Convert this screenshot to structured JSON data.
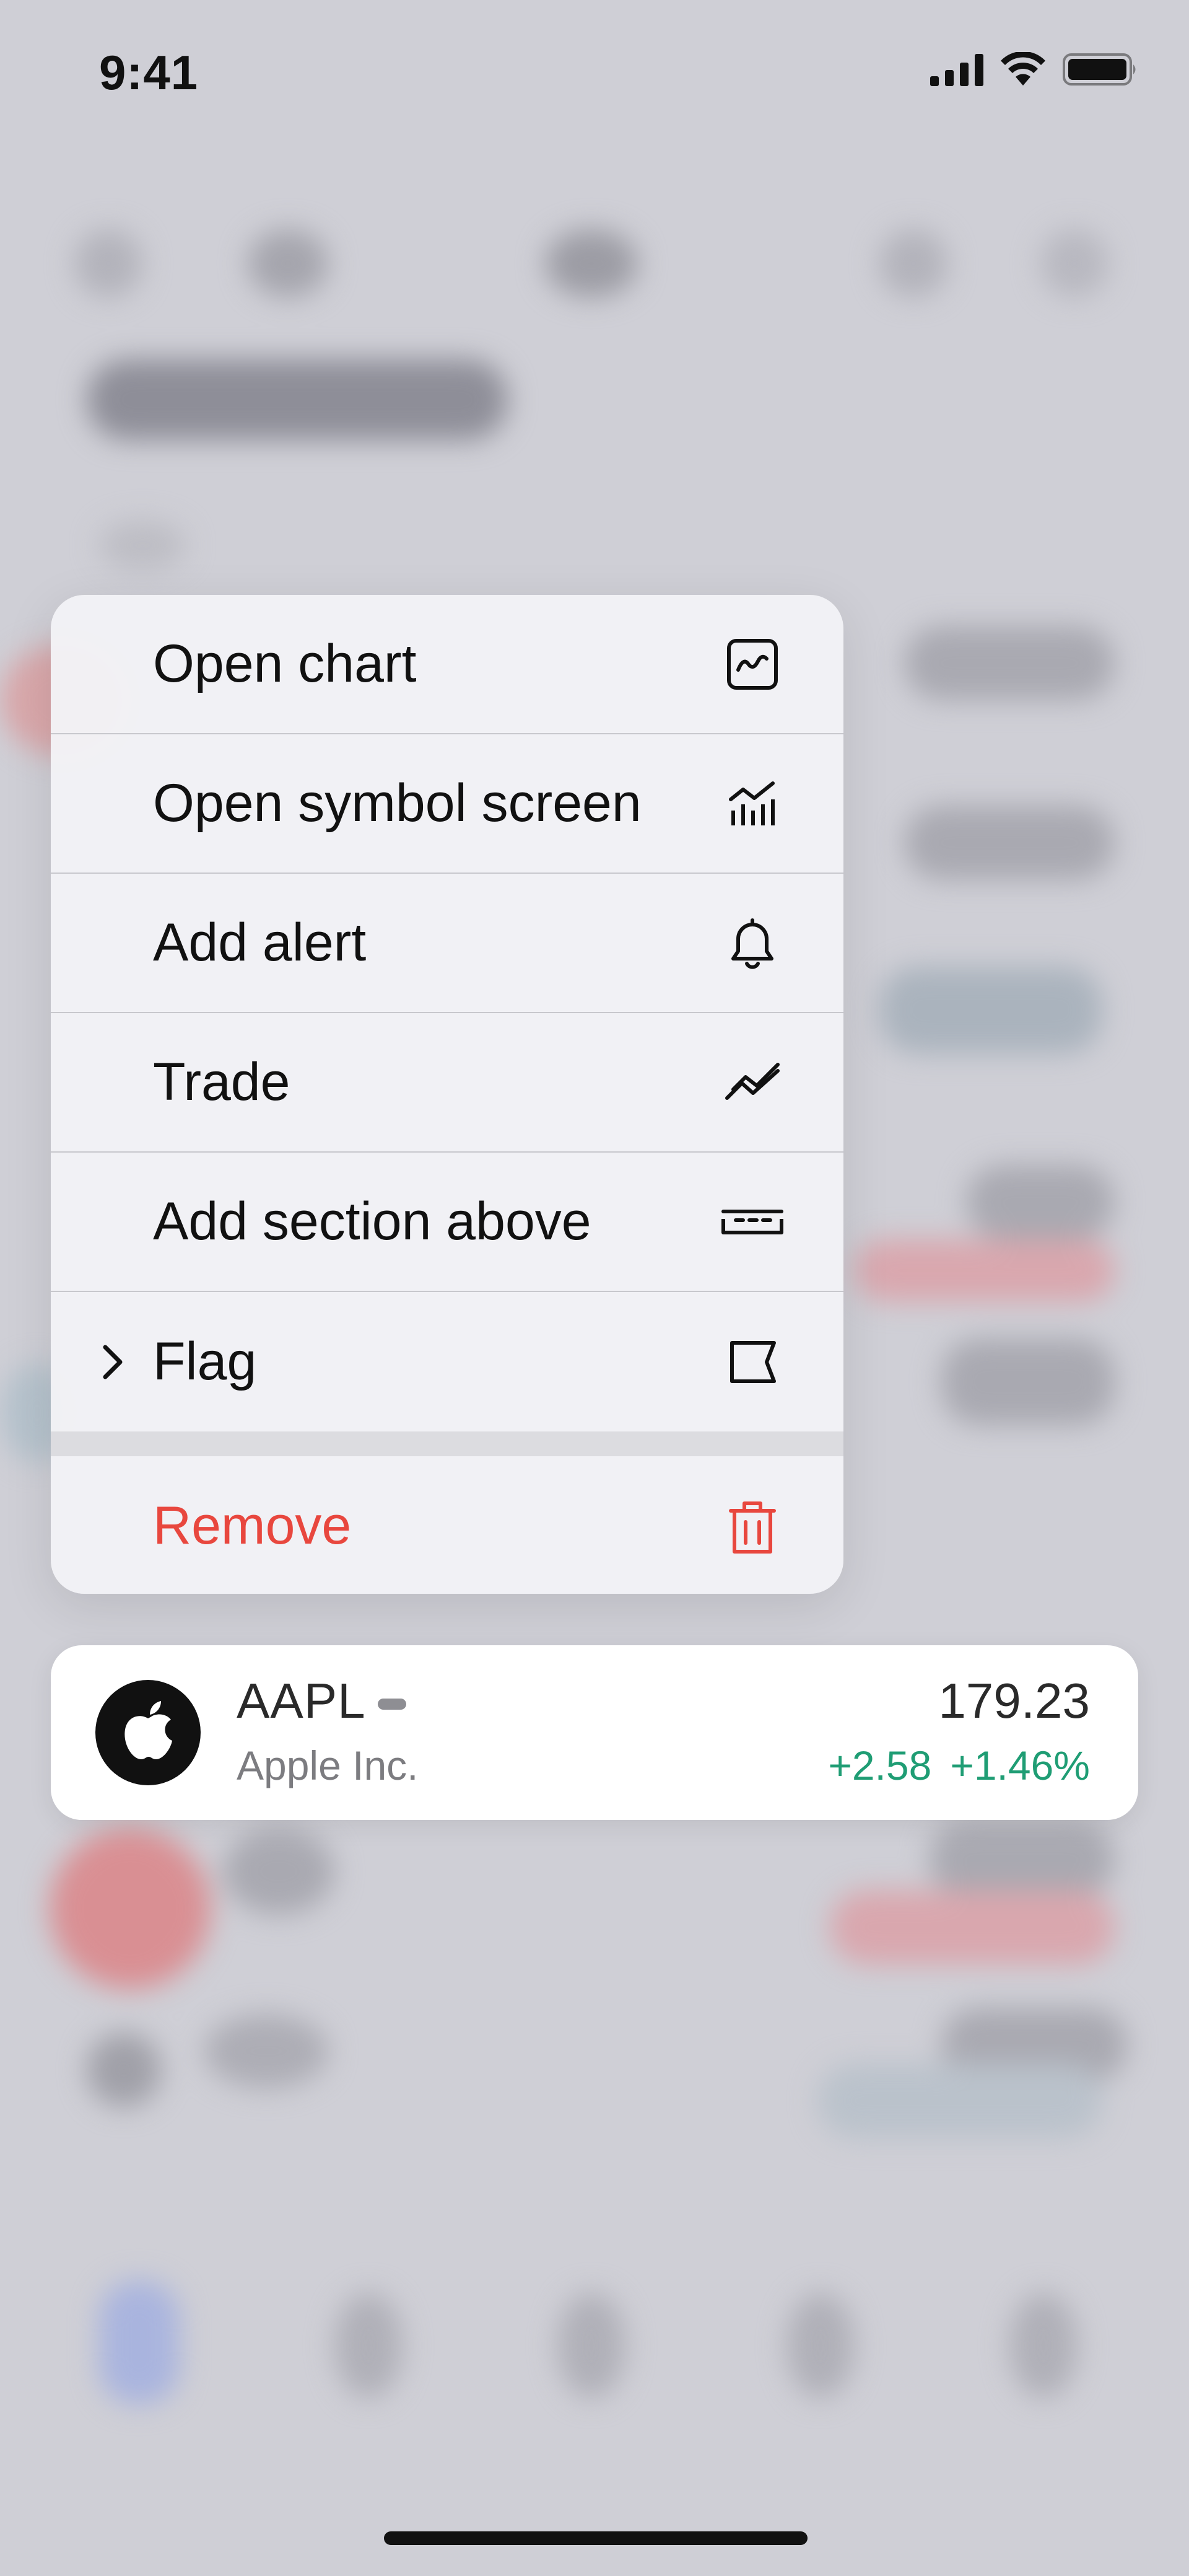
{
  "status_bar": {
    "time": "9:41",
    "icons": [
      "cellular-signal-icon",
      "wifi-icon",
      "battery-icon"
    ]
  },
  "context_menu": {
    "items": [
      {
        "label": "Open chart",
        "icon": "chart-icon"
      },
      {
        "label": "Open symbol screen",
        "icon": "symbol-screen-icon"
      },
      {
        "label": "Add alert",
        "icon": "bell-icon"
      },
      {
        "label": "Trade",
        "icon": "trade-icon"
      },
      {
        "label": "Add section above",
        "icon": "section-icon"
      },
      {
        "label": "Flag",
        "icon": "flag-icon",
        "submenu_icon": "chevron-right-icon"
      }
    ],
    "destructive": {
      "label": "Remove",
      "icon": "trash-icon",
      "color": "#e8473e"
    }
  },
  "symbol_card": {
    "symbol": "AAPL",
    "company": "Apple Inc.",
    "logo_icon": "apple-logo-icon",
    "price": "179.23",
    "change": "+2.58",
    "change_percent": "+1.46%",
    "positive_color": "#1f9d74"
  },
  "colors": {
    "background": "#cfcfd6",
    "menu_background": "#f2f2f6",
    "destructive": "#e8473e"
  }
}
